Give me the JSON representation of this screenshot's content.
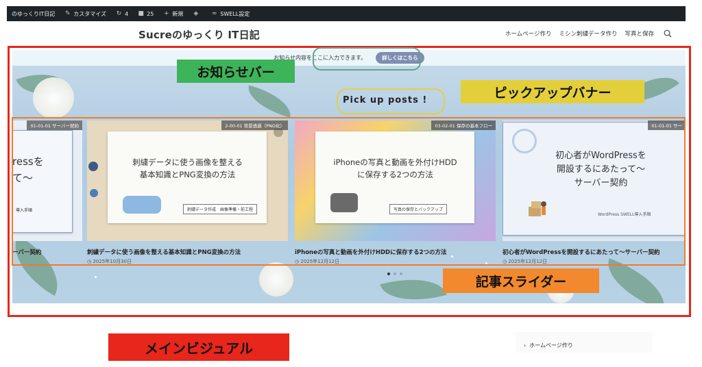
{
  "admin_bar": {
    "site": "のゆっくりIT日記",
    "customize": "カスタマイズ",
    "updates": "4",
    "comments": "25",
    "new": "新規",
    "swell": "SWELL設定"
  },
  "header": {
    "site_title": "Sucreのゆっくり IT日記",
    "nav": [
      "ホームページ作り",
      "ミシン刺繍データ作り",
      "写真と保存"
    ]
  },
  "notice_bar": {
    "text": "お知らせ内容をここに入力できます。",
    "button": "詳しくはこちら"
  },
  "pickup": {
    "title": "Pick up posts !"
  },
  "slides": [
    {
      "category": "01-01-01 サーバー契約",
      "card_text": "ressを\nて〜",
      "card_tag": "導入手順",
      "title": "ーバー契約",
      "date": ""
    },
    {
      "category": "2-00-01 背景透過（PNG化）",
      "card_text": "刺繍データに使う画像を整える\n基本知識とPNG変換の方法",
      "card_tag": "刺繍データ作成　画像準備・前工程",
      "title": "刺繍データに使う画像を整える基本知識とPNG変換の方法",
      "date": "2025年10月30日"
    },
    {
      "category": "03-02-01 保存の基本フロー",
      "card_text": "iPhoneの写真と動画を外付けHDD\nに保存する2つの方法",
      "card_tag": "写真の保存とバックアップ",
      "title": "iPhoneの写真と動画を外付けHDDに保存する2つの方法",
      "date": "2025年12月12日"
    },
    {
      "category": "01-01-01 サー",
      "card_text": "初心者がWordPressを\n開設するにあたって〜\nサーバー契約",
      "card_tag": "WordPress SWELL導入手順",
      "title": "初心者がWordPressを開設するにあたって〜サーバー契約",
      "date": "2025年12月12日"
    }
  ],
  "pager": {
    "count": 3,
    "active_index": 0
  },
  "annotations": {
    "notice_label": "お知らせバー",
    "pickup_label": "ピックアップバナー",
    "slider_label": "記事スライダー",
    "main_visual_label": "メインビジュアル"
  },
  "sidebar": {
    "link": "ホームページ作り"
  },
  "colors": {
    "admin_bar": "#1d2327",
    "notice_btn": "#7f8db1",
    "red_frame": "#e8261b",
    "orange_frame": "#f07a2a",
    "teal_frame": "#5fa58a",
    "yellow_frame": "#e4cf44",
    "green_label": "#3db35a",
    "yellow_label": "#e3cf3a",
    "orange_label": "#f2892e",
    "red_label": "#e8261b"
  }
}
